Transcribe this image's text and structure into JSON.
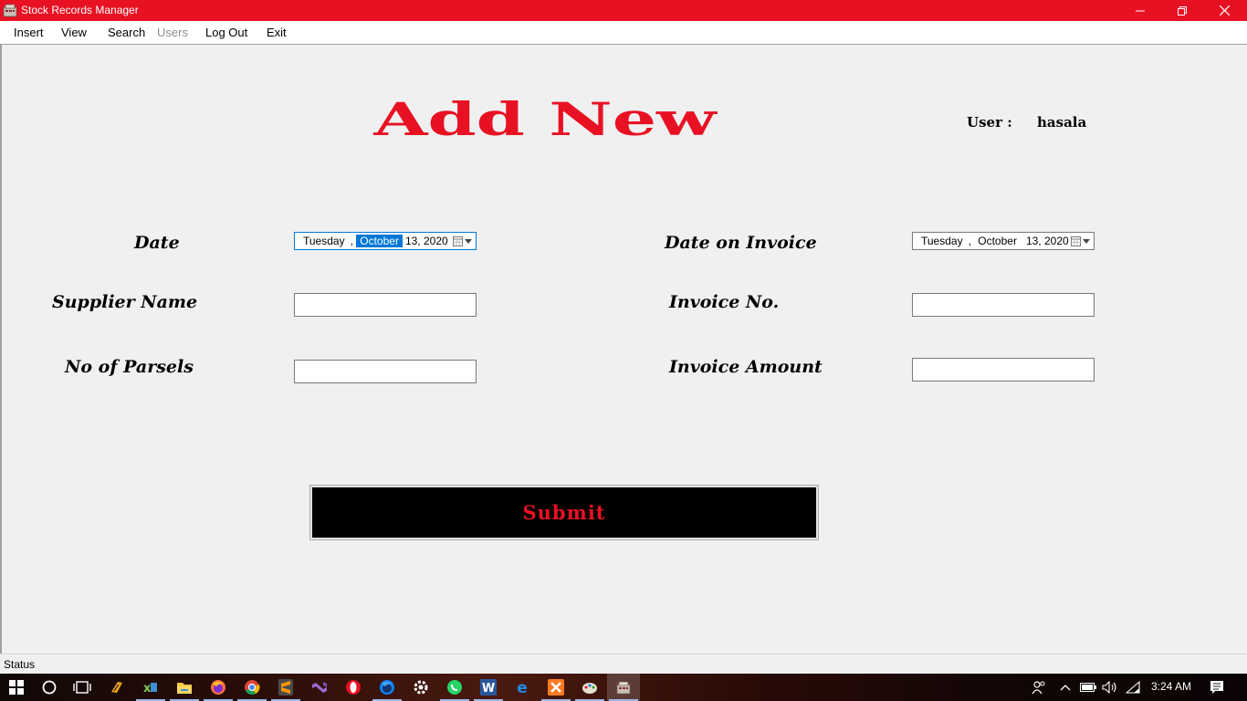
{
  "window": {
    "title": "Stock Records Manager",
    "app_icon": "stock-records-app-icon",
    "controls": [
      "minimize-icon",
      "restore-icon",
      "close-icon"
    ]
  },
  "menu": {
    "insert": "Insert",
    "view": "View",
    "search": "Search",
    "users": "Users",
    "logout": "Log Out",
    "exit": "Exit"
  },
  "form": {
    "heading": "Add New",
    "user_label": "User :",
    "user_name": "hasala",
    "date_label": "Date",
    "supplier_label": "Supplier Name",
    "parcels_label": "No of Parsels",
    "date_invoice_label": "Date on Invoice",
    "invoice_no_label": "Invoice No.",
    "invoice_amount_label": "Invoice Amount",
    "date_value": {
      "weekday": "Tuesday",
      "month": "October",
      "day_year": "13, 2020"
    },
    "invoice_date_value": {
      "weekday": "Tuesday",
      "month": "October",
      "day_year": "13, 2020"
    },
    "supplier_value": "",
    "parcels_value": "",
    "invoice_no_value": "",
    "invoice_amount_value": "",
    "submit_label": "Submit"
  },
  "status": {
    "text": "Status"
  },
  "taskbar": {
    "clock": "3:24 AM",
    "apps": [
      "start-icon",
      "search-circle-icon",
      "task-view-icon",
      "fl-studio-icon",
      "winrar-icon",
      "file-explorer-icon",
      "firefox-icon",
      "chrome-icon",
      "sublime-text-icon",
      "visual-studio-icon",
      "opera-icon",
      "firefox-developer-icon",
      "settings-gear-icon",
      "whatsapp-icon",
      "word-icon",
      "edge-icon",
      "xampp-icon",
      "paint-icon",
      "stock-records-app-icon"
    ],
    "tray": [
      "people-icon",
      "chevron-up-icon",
      "battery-icon",
      "volume-icon",
      "wifi-icon",
      "notification-icon"
    ]
  },
  "colors": {
    "accent_red": "#e81123",
    "selection_blue": "#0078d7",
    "submit_background": "#000000"
  }
}
